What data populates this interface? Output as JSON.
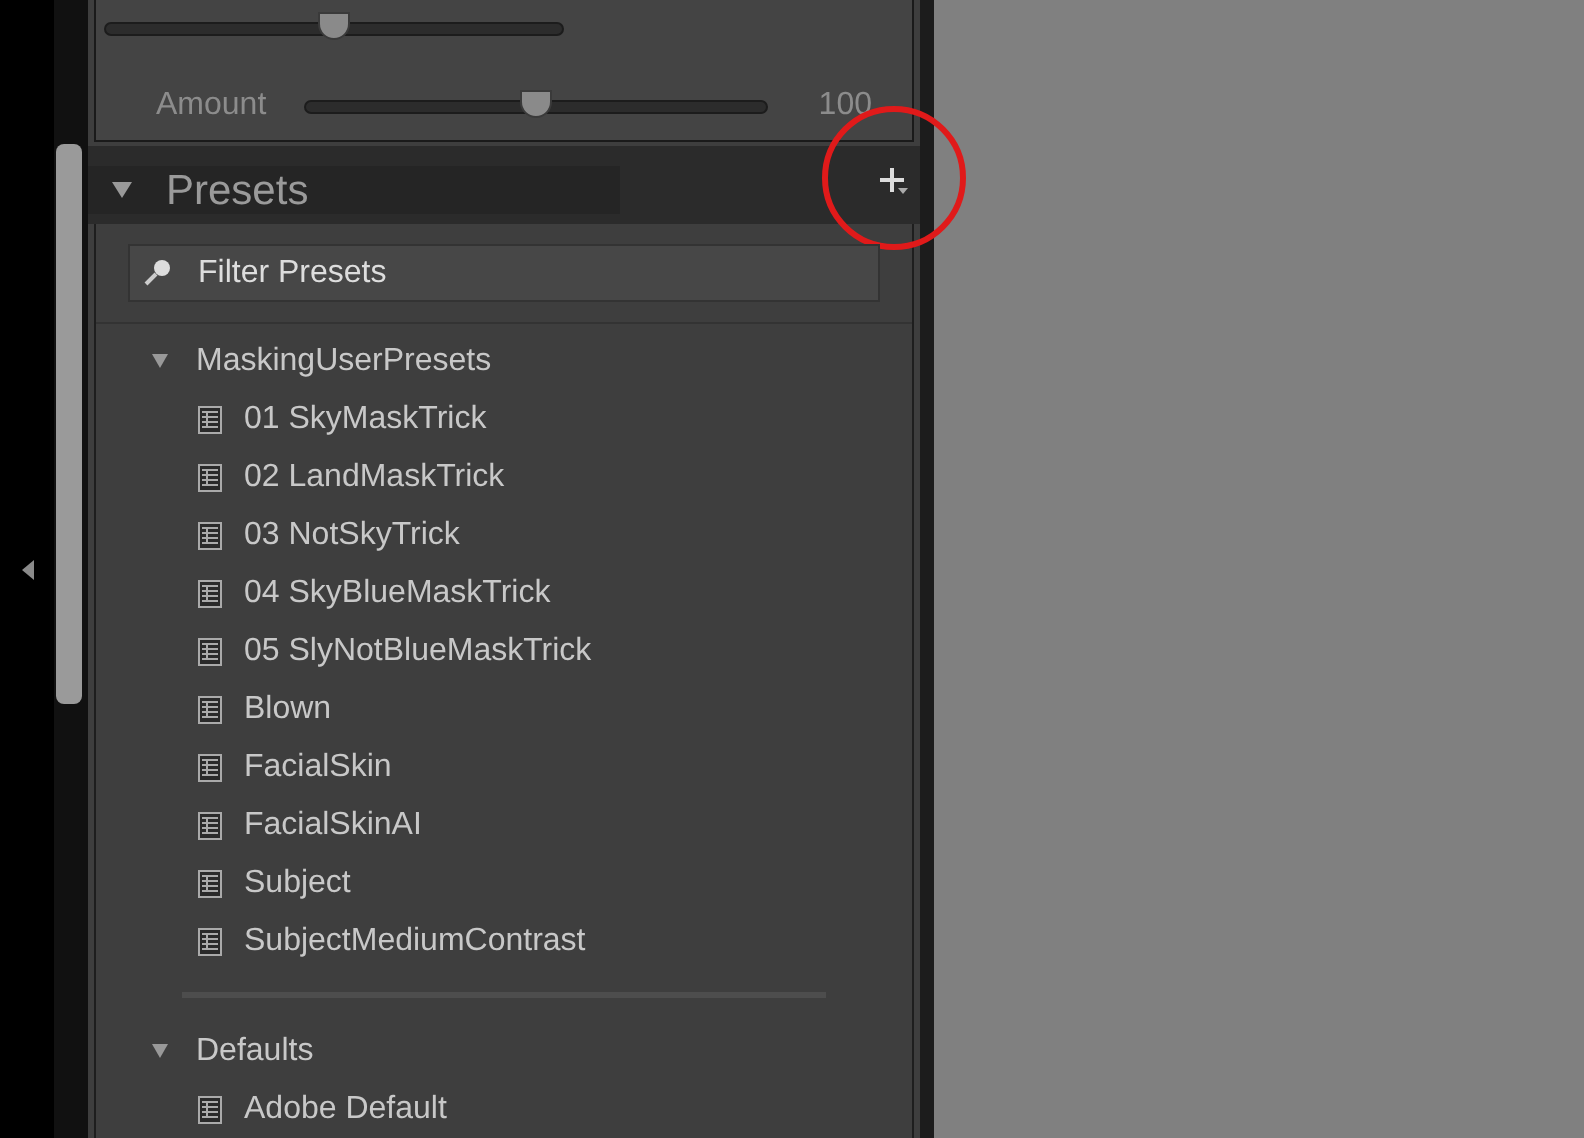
{
  "top_slider": {
    "level": 0.5
  },
  "amount": {
    "label": "Amount",
    "level": 0.5,
    "reading": "100"
  },
  "presets_panel": {
    "title": "Presets",
    "expanded": true,
    "filter": {
      "placeholder": "Filter Presets"
    },
    "groups": [
      {
        "name": "MaskingUserPresets",
        "expanded": true,
        "children": [
          {
            "name": "01 SkyMaskTrick"
          },
          {
            "name": "02 LandMaskTrick"
          },
          {
            "name": "03 NotSkyTrick"
          },
          {
            "name": "04 SkyBlueMaskTrick"
          },
          {
            "name": "05 SlyNotBlueMaskTrick"
          },
          {
            "name": "Blown"
          },
          {
            "name": "FacialSkin"
          },
          {
            "name": "FacialSkinAI"
          },
          {
            "name": "Subject"
          },
          {
            "name": "SubjectMediumContrast"
          }
        ]
      },
      {
        "name": "Defaults",
        "expanded": true,
        "children": [
          {
            "name": "Adobe Default"
          }
        ]
      }
    ]
  }
}
